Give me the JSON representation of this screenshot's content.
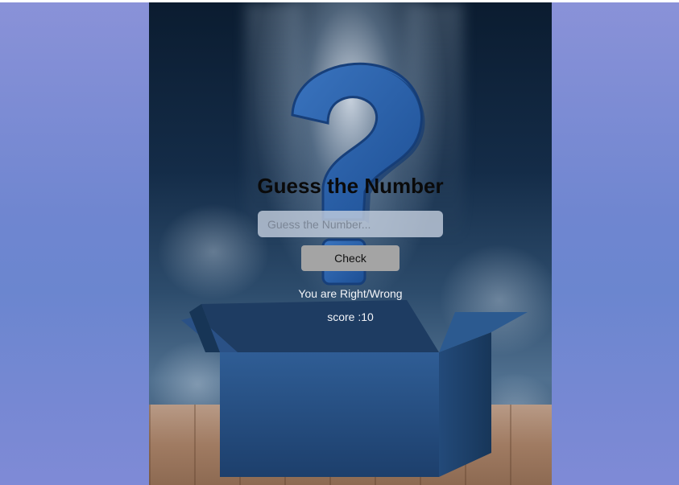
{
  "app": {
    "title": "Guess the Number"
  },
  "form": {
    "input_value": "",
    "input_placeholder": "Guess the Number...",
    "check_label": "Check"
  },
  "status": {
    "result_message": "You are Right/Wrong",
    "score_text": "score :10"
  },
  "colors": {
    "page_background": "#7a8ad4",
    "input_background": "#c8d2e1",
    "button_background": "#a4a4a4",
    "title_color": "#0a0a0a",
    "status_text_color": "#f2f4f8"
  }
}
